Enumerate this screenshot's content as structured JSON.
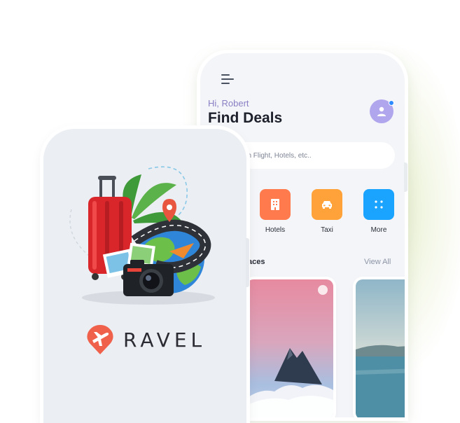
{
  "back_phone": {
    "greeting": "Hi, Robert",
    "title": "Find Deals",
    "search": {
      "placeholder": "earch Flight, Hotels, etc.."
    },
    "categories": [
      {
        "label": "Hotels",
        "icon": "building-icon",
        "color": "#ff7a4d"
      },
      {
        "label": "Taxi",
        "icon": "taxi-icon",
        "color": "#ffa23a"
      },
      {
        "label": "More",
        "icon": "grid-icon",
        "color": "#1aa3ff"
      }
    ],
    "section": {
      "label": "aces",
      "view_all": "View All"
    }
  },
  "front_phone": {
    "brand": "RAVEL",
    "logo_icon": "plane-pin-icon",
    "brand_color": "#f0614b"
  }
}
